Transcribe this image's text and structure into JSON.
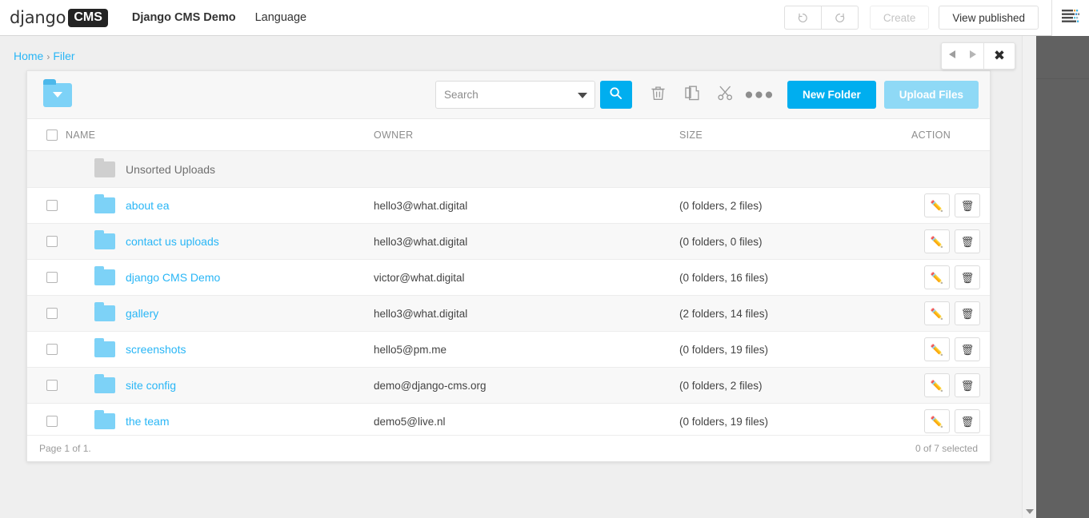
{
  "toolbar": {
    "brand_django": "django",
    "brand_cms": "CMS",
    "site_title": "Django CMS Demo",
    "language_menu": "Language",
    "undo_icon": "undo-icon",
    "redo_icon": "redo-icon",
    "create_label": "Create",
    "view_published_label": "View published",
    "menu_icon": "hamburger-icon"
  },
  "breadcrumb": {
    "home": "Home",
    "separator": "›",
    "current": "Filer"
  },
  "modal_nav": {
    "prev_icon": "triangle-left-icon",
    "next_icon": "triangle-right-icon",
    "close_icon": "close-icon"
  },
  "panel_toolbar": {
    "folder_icon": "folder-dropdown-icon",
    "search_placeholder": "Search",
    "search_value": "",
    "search_button_icon": "magnifier-icon",
    "delete_icon": "trash-icon",
    "copy_icon": "copy-icon",
    "cut_icon": "scissors-icon",
    "more_icon": "ellipsis-icon",
    "new_folder_label": "New Folder",
    "upload_files_label": "Upload Files"
  },
  "table": {
    "headers": {
      "select": "",
      "name": "NAME",
      "owner": "OWNER",
      "size": "SIZE",
      "action": "ACTION"
    },
    "unsorted": {
      "name": "Unsorted Uploads",
      "owner": "",
      "size": "",
      "icon": "folder-gray-icon"
    },
    "rows": [
      {
        "name": "about ea",
        "owner": "hello3@what.digital",
        "size": "(0 folders, 2 files)"
      },
      {
        "name": "contact us uploads",
        "owner": "hello3@what.digital",
        "size": "(0 folders, 0 files)"
      },
      {
        "name": "django CMS Demo",
        "owner": "victor@what.digital",
        "size": "(0 folders, 16 files)"
      },
      {
        "name": "gallery",
        "owner": "hello3@what.digital",
        "size": "(2 folders, 14 files)"
      },
      {
        "name": "screenshots",
        "owner": "hello5@pm.me",
        "size": "(0 folders, 19 files)"
      },
      {
        "name": "site config",
        "owner": "demo@django-cms.org",
        "size": "(0 folders, 2 files)"
      },
      {
        "name": "the team",
        "owner": "demo5@live.nl",
        "size": "(0 folders, 19 files)"
      }
    ],
    "row_action_edit_icon": "pencil-icon",
    "row_action_delete_icon": "trash-icon"
  },
  "footer": {
    "page_info": "Page 1 of 1.",
    "selection_info": "0 of 7 selected"
  },
  "colors": {
    "accent_blue": "#00aeef",
    "link_blue": "#29b6f6",
    "folder_blue": "#7dd2f7",
    "muted_blue": "#8fd9f6",
    "page_bg": "#efefef",
    "dark_overlay": "#616161"
  }
}
